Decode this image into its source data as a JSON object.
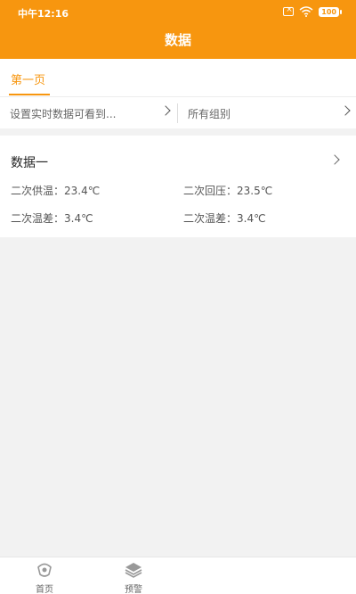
{
  "status_bar": {
    "time": "中午12:16",
    "battery": "100"
  },
  "header": {
    "title": "数据"
  },
  "tabs": [
    {
      "label": "第一页",
      "active": true
    }
  ],
  "filters": {
    "left_label": "设置实时数据可看到...",
    "right_label": "所有组别"
  },
  "card": {
    "title": "数据一",
    "metrics": [
      {
        "label": "二次供温：23.4℃"
      },
      {
        "label": "二次回压：23.5℃"
      },
      {
        "label": "二次温差：3.4℃"
      },
      {
        "label": "二次温差：3.4℃"
      }
    ]
  },
  "bottom_nav": {
    "items": [
      {
        "label": "首页",
        "icon": "home-icon"
      },
      {
        "label": "预警",
        "icon": "layers-icon"
      }
    ]
  },
  "colors": {
    "accent": "#f7960f",
    "background": "#f2f2f2"
  }
}
